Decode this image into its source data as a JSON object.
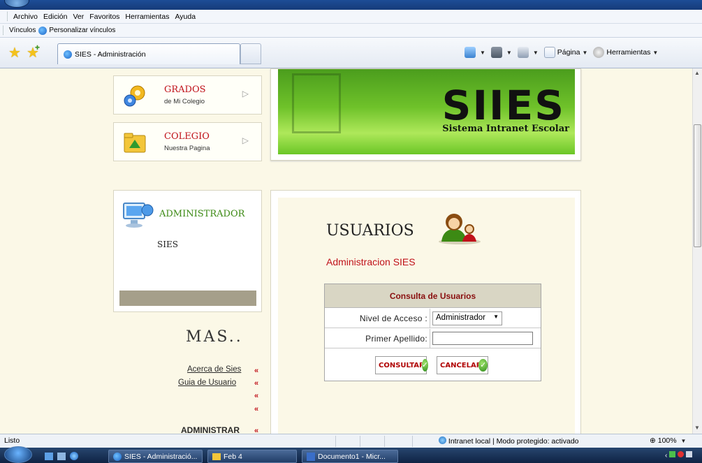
{
  "menu": [
    "Archivo",
    "Edición",
    "Ver",
    "Favoritos",
    "Herramientas",
    "Ayuda"
  ],
  "links_bar": {
    "label": "Vínculos",
    "item": "Personalizar vínculos"
  },
  "tab": {
    "title": "SIES - Administración"
  },
  "commands": {
    "page": "Página",
    "tools": "Herramientas"
  },
  "nav": [
    {
      "title": "GRADOS",
      "subtitle": "de Mi Colegio"
    },
    {
      "title": "COLEGIO",
      "subtitle": "Nuestra Pagina"
    }
  ],
  "banner": {
    "logo": "SIIES",
    "subtitle": "Sistema Intranet Escolar"
  },
  "admin": {
    "title": "ADMINISTRADOR",
    "subtitle": "SIES"
  },
  "mas": {
    "heading": "MAS..",
    "links": [
      "Acerca de Sies",
      "Guia de Usuario"
    ],
    "marker": "«",
    "admin_link": "ADMINISTRAR"
  },
  "content": {
    "title": "USUARIOS",
    "subtitle": "Administracion SIES",
    "form": {
      "header": "Consulta de Usuarios",
      "nivel_label": "Nivel de Acceso :",
      "nivel_value": "Administrador",
      "apellido_label": "Primer Apellido:",
      "apellido_value": "",
      "consultar": "CONSULTAR",
      "cancelar": "CANCELAR"
    }
  },
  "status": {
    "text": "Listo",
    "zone": "Intranet local | Modo protegido: activado",
    "zoom": "100%"
  },
  "taskbar": {
    "items": [
      "SIES - Administració...",
      "Feb 4",
      "Documento1 - Micr..."
    ]
  },
  "colors": {
    "accent_red": "#c0121a",
    "banner_green": "#6fc22a",
    "page_bg": "#fbf8e7"
  }
}
